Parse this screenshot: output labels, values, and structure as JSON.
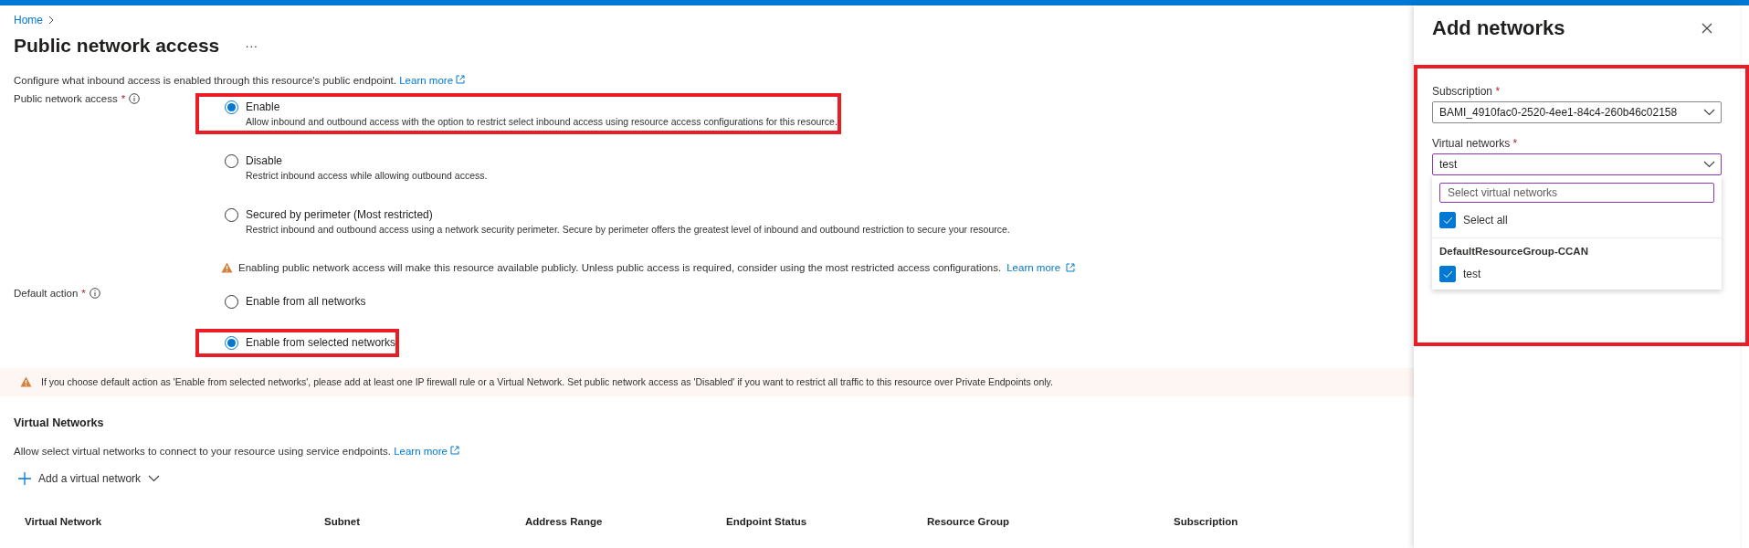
{
  "breadcrumb": {
    "items": [
      "Home"
    ]
  },
  "page": {
    "title": "Public network access",
    "more": "···"
  },
  "description": {
    "text": "Configure what inbound access is enabled through this resource's public endpoint.",
    "link": "Learn more"
  },
  "public_network_access": {
    "label": "Public network access",
    "required": "*",
    "options": [
      {
        "label": "Enable",
        "description": "Allow inbound and outbound access with the option to restrict select inbound access using resource access configurations for this resource.",
        "selected": true,
        "highlighted": true
      },
      {
        "label": "Disable",
        "description": "Restrict inbound access while allowing outbound access.",
        "selected": false,
        "highlighted": false
      },
      {
        "label": "Secured by perimeter (Most restricted)",
        "description": "Restrict inbound and outbound access using a network security perimeter. Secure by perimeter offers the greatest level of inbound and outbound restriction to secure your resource.",
        "selected": false,
        "highlighted": false
      }
    ],
    "warning": {
      "text": "Enabling public network access will make this resource available publicly. Unless public access is required, consider using the most restricted access configurations.",
      "link": "Learn more"
    }
  },
  "default_action": {
    "label": "Default action",
    "required": "*",
    "options": [
      {
        "label": "Enable from all networks",
        "selected": false,
        "highlighted": false
      },
      {
        "label": "Enable from selected networks",
        "selected": true,
        "highlighted": true
      }
    ]
  },
  "warning_banner": {
    "text": "If you choose default action as 'Enable from selected networks', please add at least one IP firewall rule or a Virtual Network. Set public network access as 'Disabled' if you want to restrict all traffic to this resource over Private Endpoints only."
  },
  "virtual_networks": {
    "heading": "Virtual Networks",
    "description": "Allow select virtual networks to connect to your resource using service endpoints.",
    "link": "Learn more",
    "add_button": "Add a virtual network",
    "table": {
      "columns": [
        "Virtual Network",
        "Subnet",
        "Address Range",
        "Endpoint Status",
        "Resource Group",
        "Subscription"
      ]
    }
  },
  "side_panel": {
    "title": "Add networks",
    "highlighted": true,
    "subscription": {
      "label": "Subscription",
      "required": "*",
      "value": "BAMI_4910fac0-2520-4ee1-84c4-260b46c02158"
    },
    "virtual_networks": {
      "label": "Virtual networks",
      "required": "*",
      "value": "test",
      "expanded": true,
      "dropdown": {
        "search": {
          "placeholder": "Select virtual networks"
        },
        "select_all": {
          "label": "Select all",
          "checked": true
        },
        "groups": [
          {
            "name": "DefaultResourceGroup-CCAN",
            "items": [
              {
                "label": "test",
                "checked": true
              }
            ]
          }
        ]
      }
    }
  }
}
